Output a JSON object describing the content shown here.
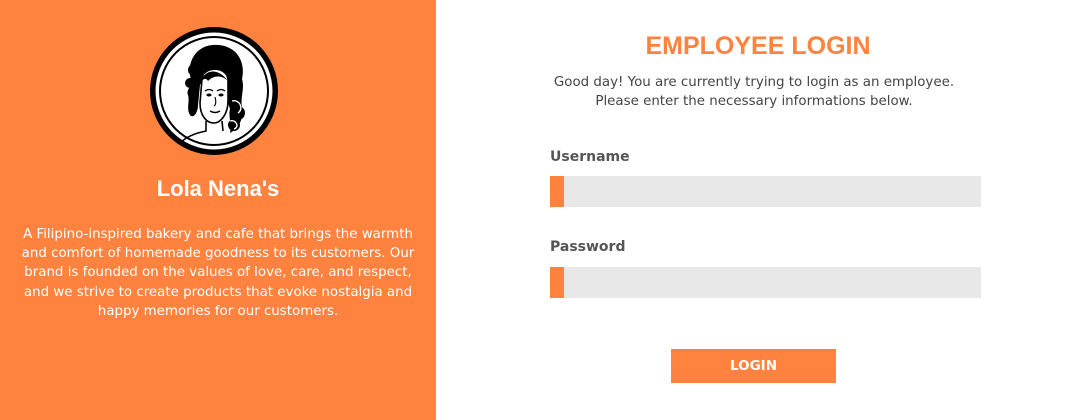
{
  "brand": {
    "name": "Lola Nena's",
    "description": "A Filipino-inspired bakery and cafe that brings the warmth and comfort of homemade goodness to its customers. Our brand is founded on the values of love, care, and respect, and we strive to create products that evoke nostalgia and happy memories for our customers.",
    "logo_icon": "woman-portrait-icon"
  },
  "login": {
    "title": "EMPLOYEE LOGIN",
    "intro": "Good day! You are currently trying to login as an employee. Please enter the necessary informations below.",
    "username_label": "Username",
    "username_value": "",
    "password_label": "Password",
    "password_value": "",
    "button_label": "LOGIN"
  },
  "colors": {
    "accent": "#ff823e",
    "input_background": "#e8e8e8",
    "text": "#444444"
  }
}
